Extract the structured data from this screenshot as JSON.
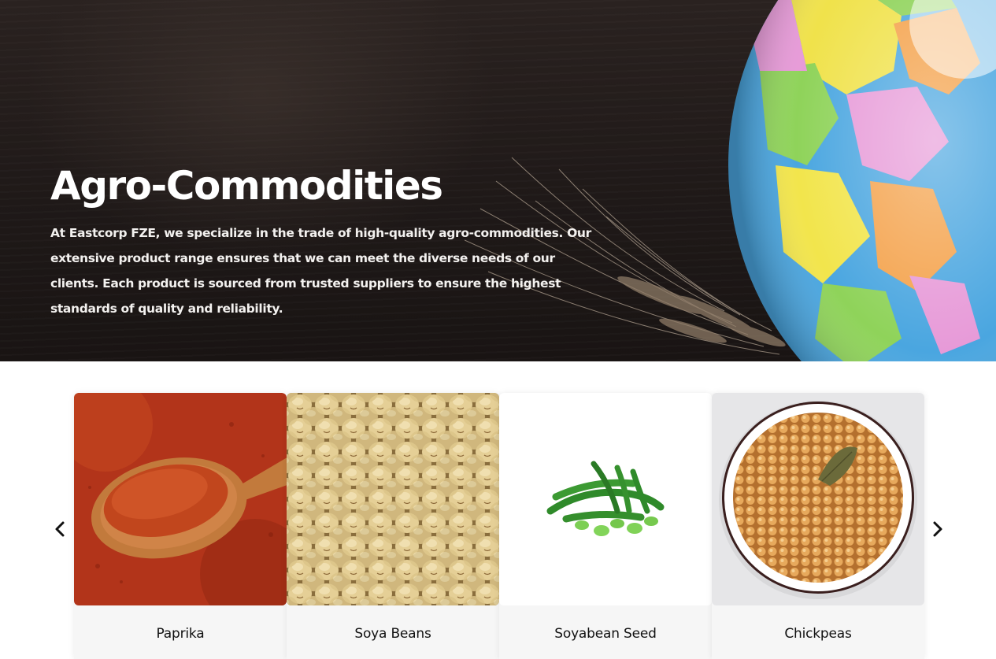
{
  "hero": {
    "title": "Agro-Commodities",
    "description": "At Eastcorp FZE, we specialize in the trade of high-quality agro-commodities. Our extensive product range ensures that we can meet the diverse needs of our clients. Each product is sourced from trusted suppliers to ensure the highest standards of quality and reliability.",
    "background_icon": "globe-and-wheat-image"
  },
  "carousel": {
    "prev_icon": "chevron-left-icon",
    "next_icon": "chevron-right-icon",
    "products": [
      {
        "name": "Paprika",
        "image": "paprika-image"
      },
      {
        "name": "Soya Beans",
        "image": "soya-beans-image"
      },
      {
        "name": "Soyabean Seed",
        "image": "soyabean-seed-image"
      },
      {
        "name": "Chickpeas",
        "image": "chickpeas-image"
      }
    ]
  },
  "colors": {
    "hero_bg": "#1f1918",
    "text_light": "#ffffff",
    "card_bg": "#f6f6f6",
    "text_dark": "#111111"
  }
}
